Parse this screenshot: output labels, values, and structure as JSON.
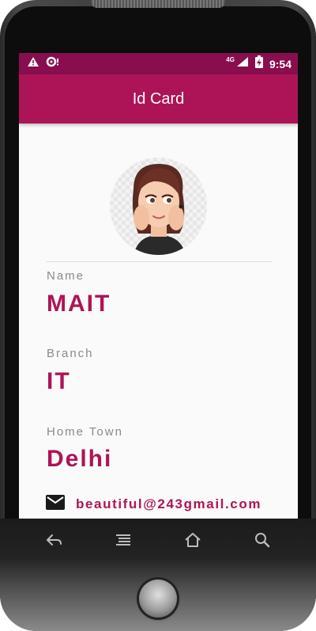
{
  "status_bar": {
    "time": "9:54",
    "network": "4G",
    "bg_color": "#880e4f",
    "icons": [
      "warning-icon",
      "notification-icon",
      "signal-icon",
      "battery-charging-icon"
    ]
  },
  "app_bar": {
    "title": "Id Card",
    "bg_color": "#ad1457"
  },
  "profile": {
    "avatar": "cartoon-girl-avatar",
    "fields": [
      {
        "label": "Name",
        "value": "MAIT"
      },
      {
        "label": "Branch",
        "value": "IT"
      },
      {
        "label": "Home Town",
        "value": "Delhi"
      }
    ],
    "email": "beautiful@243gmail.com",
    "email_icon": "email-icon",
    "accent_color": "#ad1457"
  },
  "nav_keys": [
    "back-icon",
    "menu-icon",
    "home-icon",
    "search-icon"
  ]
}
